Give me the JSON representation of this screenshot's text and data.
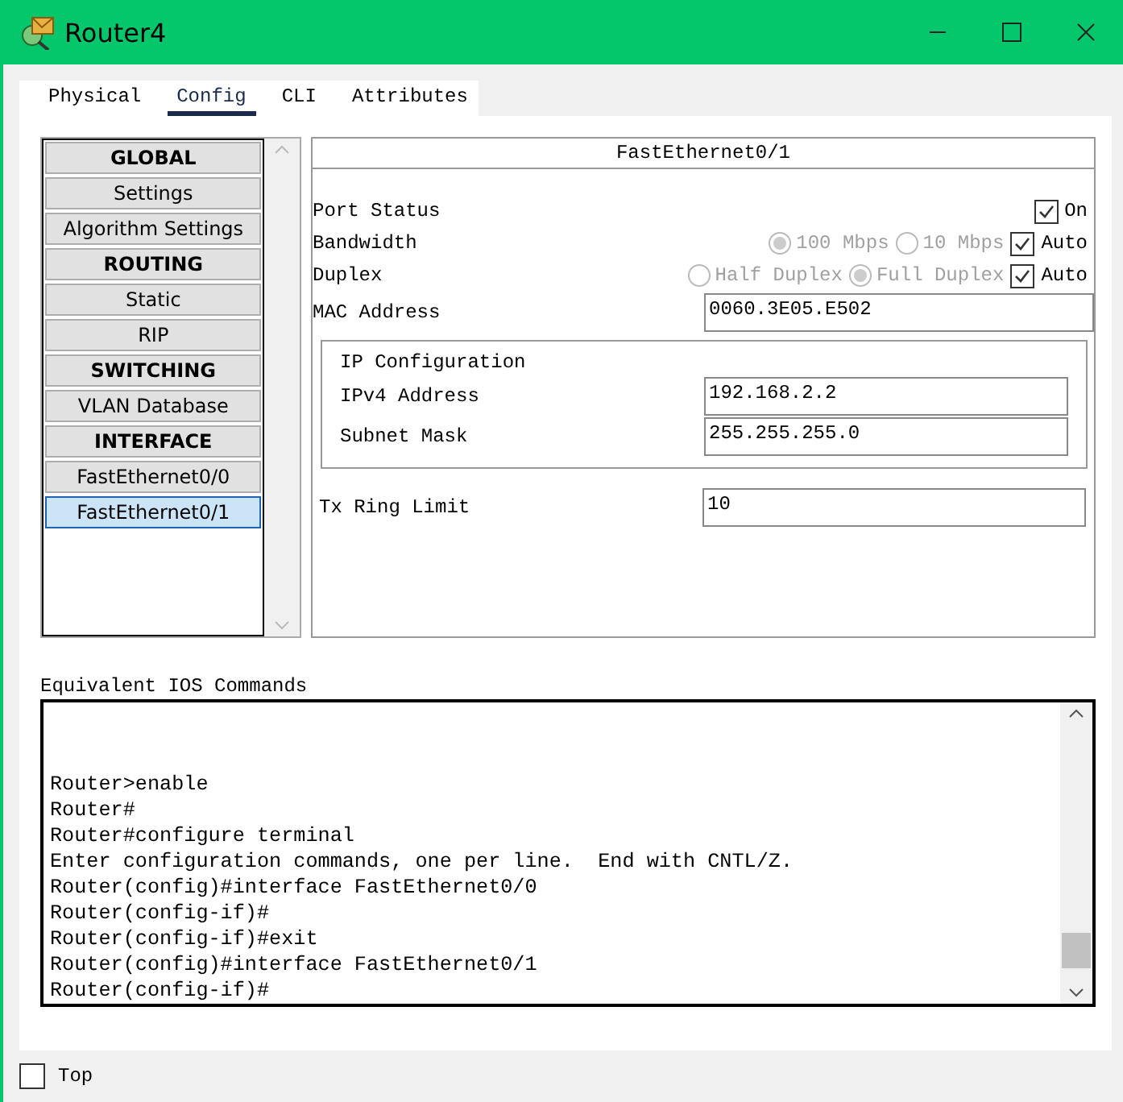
{
  "window": {
    "title": "Router4"
  },
  "tabs": [
    {
      "label": "Physical",
      "selected": false
    },
    {
      "label": "Config",
      "selected": true
    },
    {
      "label": "CLI",
      "selected": false
    },
    {
      "label": "Attributes",
      "selected": false
    }
  ],
  "sidebar": {
    "items": [
      {
        "label": "GLOBAL",
        "kind": "header",
        "selected": false
      },
      {
        "label": "Settings",
        "kind": "item",
        "selected": false
      },
      {
        "label": "Algorithm Settings",
        "kind": "item",
        "selected": false
      },
      {
        "label": "ROUTING",
        "kind": "header",
        "selected": false
      },
      {
        "label": "Static",
        "kind": "item",
        "selected": false
      },
      {
        "label": "RIP",
        "kind": "item",
        "selected": false
      },
      {
        "label": "SWITCHING",
        "kind": "header",
        "selected": false
      },
      {
        "label": "VLAN Database",
        "kind": "item",
        "selected": false
      },
      {
        "label": "INTERFACE",
        "kind": "header",
        "selected": false
      },
      {
        "label": "FastEthernet0/0",
        "kind": "item",
        "selected": false
      },
      {
        "label": "FastEthernet0/1",
        "kind": "item",
        "selected": true
      }
    ]
  },
  "panel": {
    "title": "FastEthernet0/1",
    "port_status": {
      "label": "Port Status",
      "on_label": "On",
      "checked": true
    },
    "bandwidth": {
      "label": "Bandwidth",
      "disabled": true,
      "options": [
        {
          "label": "100 Mbps",
          "selected": true
        },
        {
          "label": "10 Mbps",
          "selected": false
        }
      ],
      "auto_label": "Auto",
      "auto_checked": true
    },
    "duplex": {
      "label": "Duplex",
      "disabled": true,
      "options": [
        {
          "label": "Half Duplex",
          "selected": false
        },
        {
          "label": "Full Duplex",
          "selected": true
        }
      ],
      "auto_label": "Auto",
      "auto_checked": true
    },
    "mac": {
      "label": "MAC Address",
      "value": "0060.3E05.E502"
    },
    "ip_config": {
      "title": "IP Configuration",
      "fields": [
        {
          "label": "IPv4 Address",
          "value": "192.168.2.2"
        },
        {
          "label": "Subnet Mask",
          "value": "255.255.255.0"
        }
      ]
    },
    "tx_ring": {
      "label": "Tx Ring Limit",
      "value": "10"
    }
  },
  "ios": {
    "label": "Equivalent IOS Commands",
    "lines": [
      "Router>enable",
      "Router#",
      "Router#configure terminal",
      "Enter configuration commands, one per line.  End with CNTL/Z.",
      "Router(config)#interface FastEthernet0/0",
      "Router(config-if)#",
      "Router(config-if)#exit",
      "Router(config)#interface FastEthernet0/1",
      "Router(config-if)#"
    ]
  },
  "top": {
    "label": "Top",
    "checked": false
  }
}
